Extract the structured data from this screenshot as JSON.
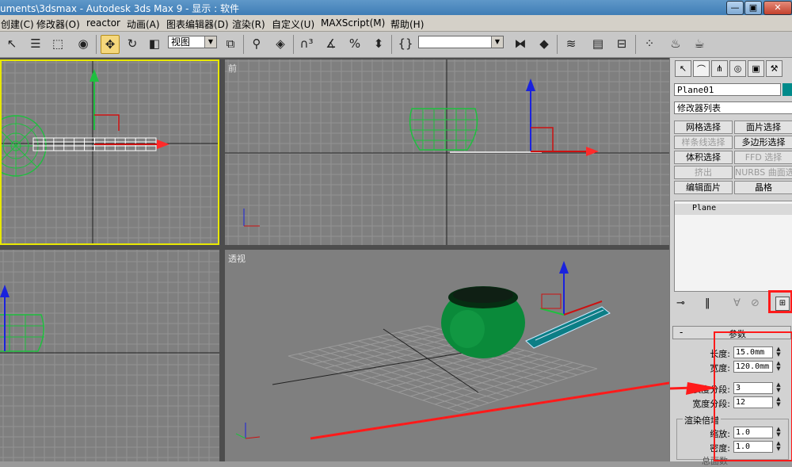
{
  "title_bar": {
    "text": "uments\\3dsmax    - Autodesk 3ds Max 9    - 显示 : 软件",
    "min_label": "—",
    "max_label": "▣",
    "close_label": "✕"
  },
  "menu": [
    "创建(C)",
    "修改器(O)",
    "reactor",
    "动画(A)",
    "图表编辑器(D)",
    "渲染(R)",
    "自定义(U)",
    "MAXScript(M)",
    "帮助(H)"
  ],
  "toolbar": {
    "view_dropdown": "视图",
    "selection_set_dropdown": ""
  },
  "viewports": {
    "top_left": {
      "label": ""
    },
    "front": {
      "label": "前"
    },
    "bottom_left": {
      "label": ""
    },
    "perspective": {
      "label": "透视"
    }
  },
  "command_panel": {
    "object_name": "Plane01",
    "object_color": "#008a8a",
    "modifier_list": "修改器列表",
    "buttons": [
      [
        "网格选择",
        "面片选择"
      ],
      [
        "样条线选择",
        "多边形选择"
      ],
      [
        "体积选择",
        "FFD 选择"
      ],
      [
        "挤出",
        "NURBS 曲面选择"
      ],
      [
        "编辑面片",
        "晶格"
      ]
    ],
    "stack_item": "Plane",
    "rollout_toggle": "-",
    "rollout_title": "参数",
    "params": {
      "length_label": "长度:",
      "length_value": "15.0mm",
      "width_label": "宽度:",
      "width_value": "120.0mm",
      "length_segs_label": "长度分段:",
      "length_segs_value": "3",
      "width_segs_label": "宽度分段:",
      "width_segs_value": "12"
    },
    "render_group_label": "渲染倍增",
    "render": {
      "scale_label": "缩放:",
      "scale_value": "1.0",
      "density_label": "密度:",
      "density_value": "1.0"
    },
    "cutoff_text": "总面数"
  },
  "colors": {
    "highlight_red": "#ff1a1a",
    "active_viewport_border": "#e8e800",
    "teapot_green": "#0a8a3a",
    "wire_green": "#1fbf3f"
  }
}
